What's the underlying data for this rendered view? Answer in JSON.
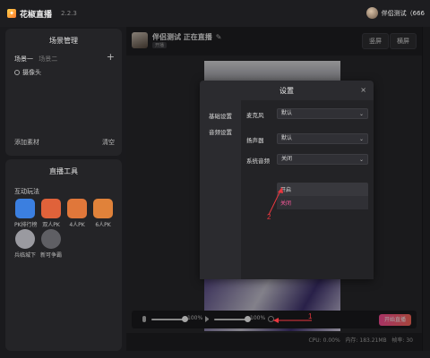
{
  "app": {
    "name": "花椒直播",
    "version": "2.2.3"
  },
  "user": {
    "name": "伴侣测试（666"
  },
  "scene_panel": {
    "title": "场景管理",
    "tabs": [
      "场景一",
      "场景二"
    ],
    "add_icon": "plus-icon",
    "sources": [
      {
        "label": "摄像头",
        "visible": true
      }
    ],
    "add_material": "添加素材",
    "clear": "清空"
  },
  "tools_panel": {
    "title": "直播工具",
    "section": "互动玩法",
    "items": [
      {
        "label": "PK排行榜",
        "color": "#3b7fe0"
      },
      {
        "label": "双人PK",
        "color": "#e0623a"
      },
      {
        "label": "4人PK",
        "color": "#e0773a"
      },
      {
        "label": "6人PK",
        "color": "#e0823a"
      },
      {
        "label": "兵临城下",
        "color": "#9a9aa0"
      },
      {
        "label": "新可争霸",
        "color": "#5f5f64"
      }
    ]
  },
  "room": {
    "title": "伴侣测试 正在直播",
    "tag": "开播",
    "portrait_label": "竖屏",
    "landscape_label": "横屏"
  },
  "controls": {
    "mic_level": "100%",
    "speaker_level": "100%",
    "golive_label": "开始直播"
  },
  "status": {
    "cpu_label": "CPU:",
    "cpu": "0.00%",
    "mem_label": "内存:",
    "mem": "183.21MB",
    "fps_label": "帧率:",
    "fps": "30"
  },
  "dialog": {
    "title": "设置",
    "close": "×",
    "sidebar": [
      "基础设置",
      "音频设置"
    ],
    "rows": [
      {
        "label": "麦克风",
        "value": "默认"
      },
      {
        "label": "扬声器",
        "value": "默认"
      },
      {
        "label": "系统音频",
        "value": "关闭"
      }
    ],
    "dropdown_options": [
      "开启",
      "关闭"
    ],
    "selected_option": "关闭"
  },
  "annotations": [
    "1",
    "2"
  ],
  "colors": {
    "accent": "#ff4f9a",
    "annotation": "#e8373f"
  }
}
